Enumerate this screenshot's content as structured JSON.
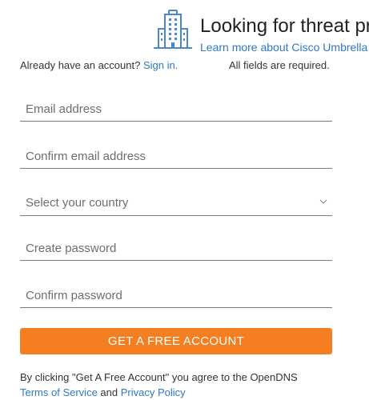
{
  "promo": {
    "title": "Looking for threat protection?",
    "link": "Learn more about Cisco Umbrella",
    "icon": "building-icon"
  },
  "account": {
    "prompt": "Already have an account? ",
    "signin": "Sign in.",
    "required": "All fields are required."
  },
  "form": {
    "email_placeholder": "Email address",
    "confirm_email_placeholder": "Confirm email address",
    "country_placeholder": "Select your country",
    "password_placeholder": "Create password",
    "confirm_password_placeholder": "Confirm password",
    "submit_label": "GET A FREE ACCOUNT"
  },
  "terms": {
    "text": "By clicking \"Get A Free Account\" you agree to the OpenDNS",
    "tos": "Terms of Service",
    "and": " and ",
    "privacy": "Privacy Policy"
  },
  "colors": {
    "accent": "#f57f20",
    "link": "#2f78c4",
    "icon": "#4a86d1"
  }
}
